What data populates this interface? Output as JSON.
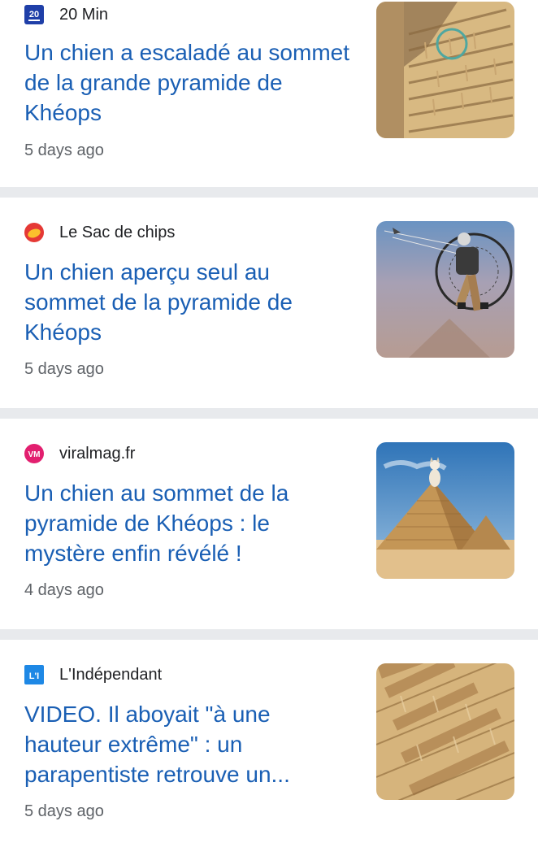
{
  "articles": [
    {
      "source": "20 Min",
      "source_icon": "20-min-logo-icon",
      "title": "Un chien a escaladé au sommet de la grande pyramide de Khéops",
      "time": "5 days ago",
      "thumbnail": "pyramid-stones-with-dog-thumbnail"
    },
    {
      "source": "Le Sac de chips",
      "source_icon": "le-sac-de-chips-logo-icon",
      "title": "Un chien aperçu seul au sommet de la pyramide de Khéops",
      "time": "5 days ago",
      "thumbnail": "paraglider-thumbnail"
    },
    {
      "source": "viralmag.fr",
      "source_icon": "viralmag-logo-icon",
      "title": "Un chien au sommet de la pyramide de Khéops : le mystère enfin révélé !",
      "time": "4 days ago",
      "thumbnail": "dog-on-pyramid-thumbnail"
    },
    {
      "source": "L'Indépendant",
      "source_icon": "lindependant-logo-icon",
      "title": "VIDEO. Il aboyait \"à une hauteur extrême\" : un parapentiste retrouve un...",
      "time": "5 days ago",
      "thumbnail": "pyramid-stone-blocks-thumbnail"
    }
  ],
  "logos": {
    "c1": "20",
    "c3": "VM",
    "c4": "L'I"
  },
  "colors": {
    "title": "#1a5fb4",
    "meta": "#5f6368",
    "divider": "#e8eaed"
  }
}
